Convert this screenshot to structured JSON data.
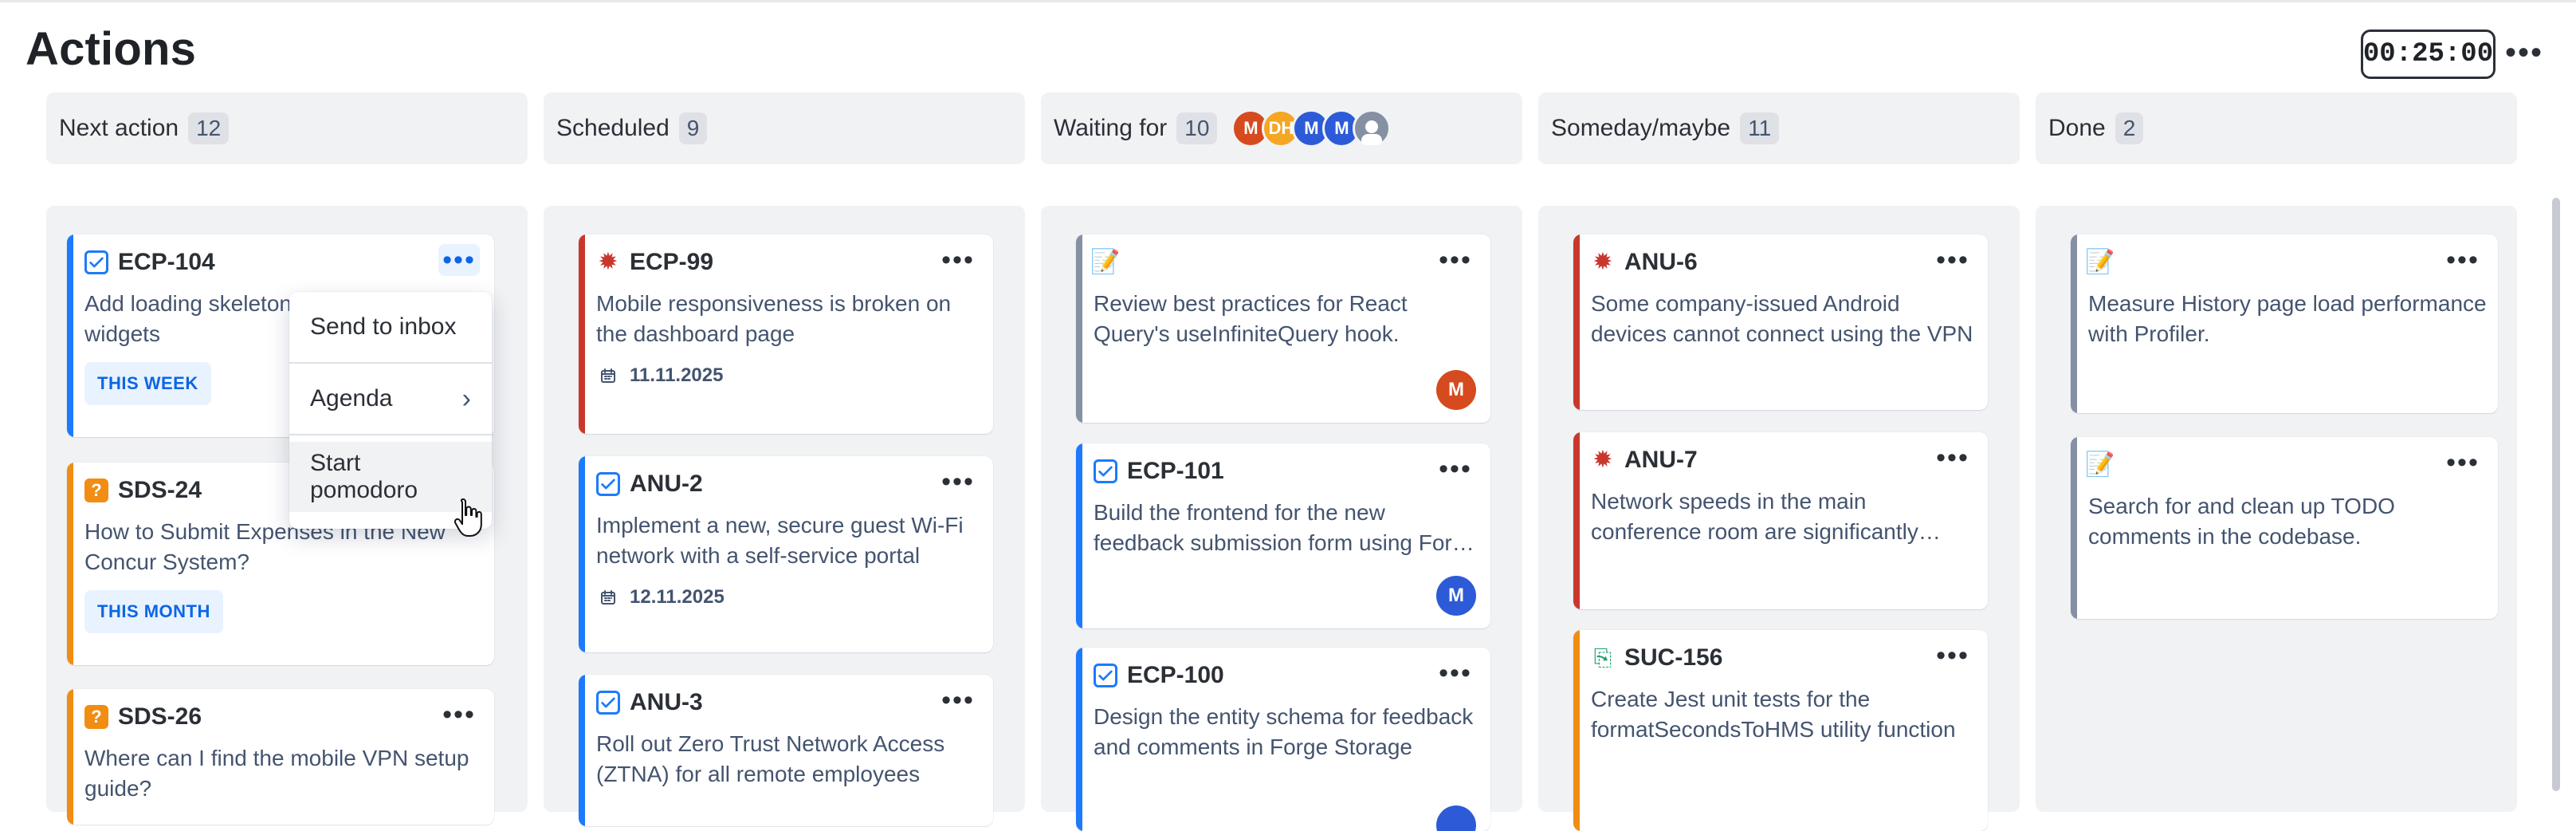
{
  "page": {
    "title": "Actions",
    "timer": "00:25:00",
    "top_more_label": "•••"
  },
  "columns": [
    {
      "title": "Next action",
      "count": "12",
      "avatars": []
    },
    {
      "title": "Scheduled",
      "count": "9",
      "avatars": []
    },
    {
      "title": "Waiting for",
      "count": "10",
      "avatars": [
        {
          "label": "M",
          "color": "#d64a1f"
        },
        {
          "label": "DH",
          "color": "#f5a623"
        },
        {
          "label": "M",
          "color": "#2d5bd7"
        },
        {
          "label": "M",
          "color": "#2d5bd7"
        },
        {
          "label": "",
          "color": "#8590a2"
        }
      ]
    },
    {
      "title": "Someday/maybe",
      "count": "11",
      "avatars": []
    },
    {
      "title": "Done",
      "count": "2",
      "avatars": []
    }
  ],
  "cards": {
    "c1": {
      "key": "ECP-104",
      "title": "Add loading skeleton to the dashboard widgets",
      "badge": "THIS WEEK",
      "left_color": "#1d7afc",
      "icon": "task-checkbox-icon",
      "more": "•••"
    },
    "c2": {
      "key": "SDS-24",
      "title": "How to Submit Expenses in the New Concur System?",
      "badge": "THIS MONTH",
      "left_color": "#f18d13",
      "icon": "question-icon",
      "more": "•••"
    },
    "c3": {
      "key": "SDS-26",
      "title": "Where can I find the mobile VPN setup guide?",
      "left_color": "#f18d13",
      "icon": "question-icon",
      "more": "•••"
    },
    "c4": {
      "key": "ECP-99",
      "title": "Mobile responsiveness is broken on the dashboard page",
      "date": "11.11.2025",
      "left_color": "#c9372c",
      "icon": "bug-icon",
      "more": "•••"
    },
    "c5": {
      "key": "ANU-2",
      "title": "Implement a new, secure guest Wi-Fi network with a self-service portal",
      "date": "12.11.2025",
      "left_color": "#1d7afc",
      "icon": "task-checkbox-icon",
      "more": "•••"
    },
    "c6": {
      "key": "ANU-3",
      "title": "Roll out Zero Trust Network Access (ZTNA) for all remote employees",
      "left_color": "#1d7afc",
      "icon": "task-checkbox-icon",
      "more": "•••"
    },
    "c7": {
      "key": "",
      "title": "Review best practices for React Query's useInfiniteQuery hook.",
      "left_color": "#8590a2",
      "icon": "note-icon",
      "assignee": {
        "label": "M",
        "color": "#d64a1f"
      },
      "more": "•••"
    },
    "c8": {
      "key": "ECP-101",
      "title": "Build the frontend for the new feedback submission form using Forge UI Kit",
      "left_color": "#1d7afc",
      "icon": "task-checkbox-icon",
      "assignee": {
        "label": "M",
        "color": "#2d5bd7"
      },
      "more": "•••"
    },
    "c9": {
      "key": "ECP-100",
      "title": "Design the entity schema for feedback and comments in Forge Storage",
      "left_color": "#1d7afc",
      "icon": "task-checkbox-icon",
      "assignee": {
        "label": "",
        "color": "#2d5bd7"
      },
      "more": "•••"
    },
    "c10": {
      "key": "ANU-6",
      "title": "Some company-issued Android devices cannot connect using the VPN",
      "left_color": "#c9372c",
      "icon": "bug-icon",
      "more": "•••"
    },
    "c11": {
      "key": "ANU-7",
      "title": "Network speeds in the main conference room are significantly slower",
      "left_color": "#c9372c",
      "icon": "bug-icon",
      "more": "•••"
    },
    "c12": {
      "key": "SUC-156",
      "title": "Create Jest unit tests for the formatSecondsToHMS utility function",
      "left_color": "#f18d13",
      "icon": "story-icon",
      "more": "•••"
    },
    "c13": {
      "key": "",
      "title": "Measure History page load performance with Profiler.",
      "left_color": "#8590a2",
      "icon": "note-icon",
      "more": "•••"
    },
    "c14": {
      "key": "",
      "title": "Search for and clean up TODO comments in the codebase.",
      "left_color": "#8590a2",
      "icon": "note-icon",
      "more": "•••"
    }
  },
  "context_menu": {
    "items": [
      "Send to inbox",
      "Agenda",
      "Start pomodoro"
    ],
    "agenda_chevron": "›"
  }
}
